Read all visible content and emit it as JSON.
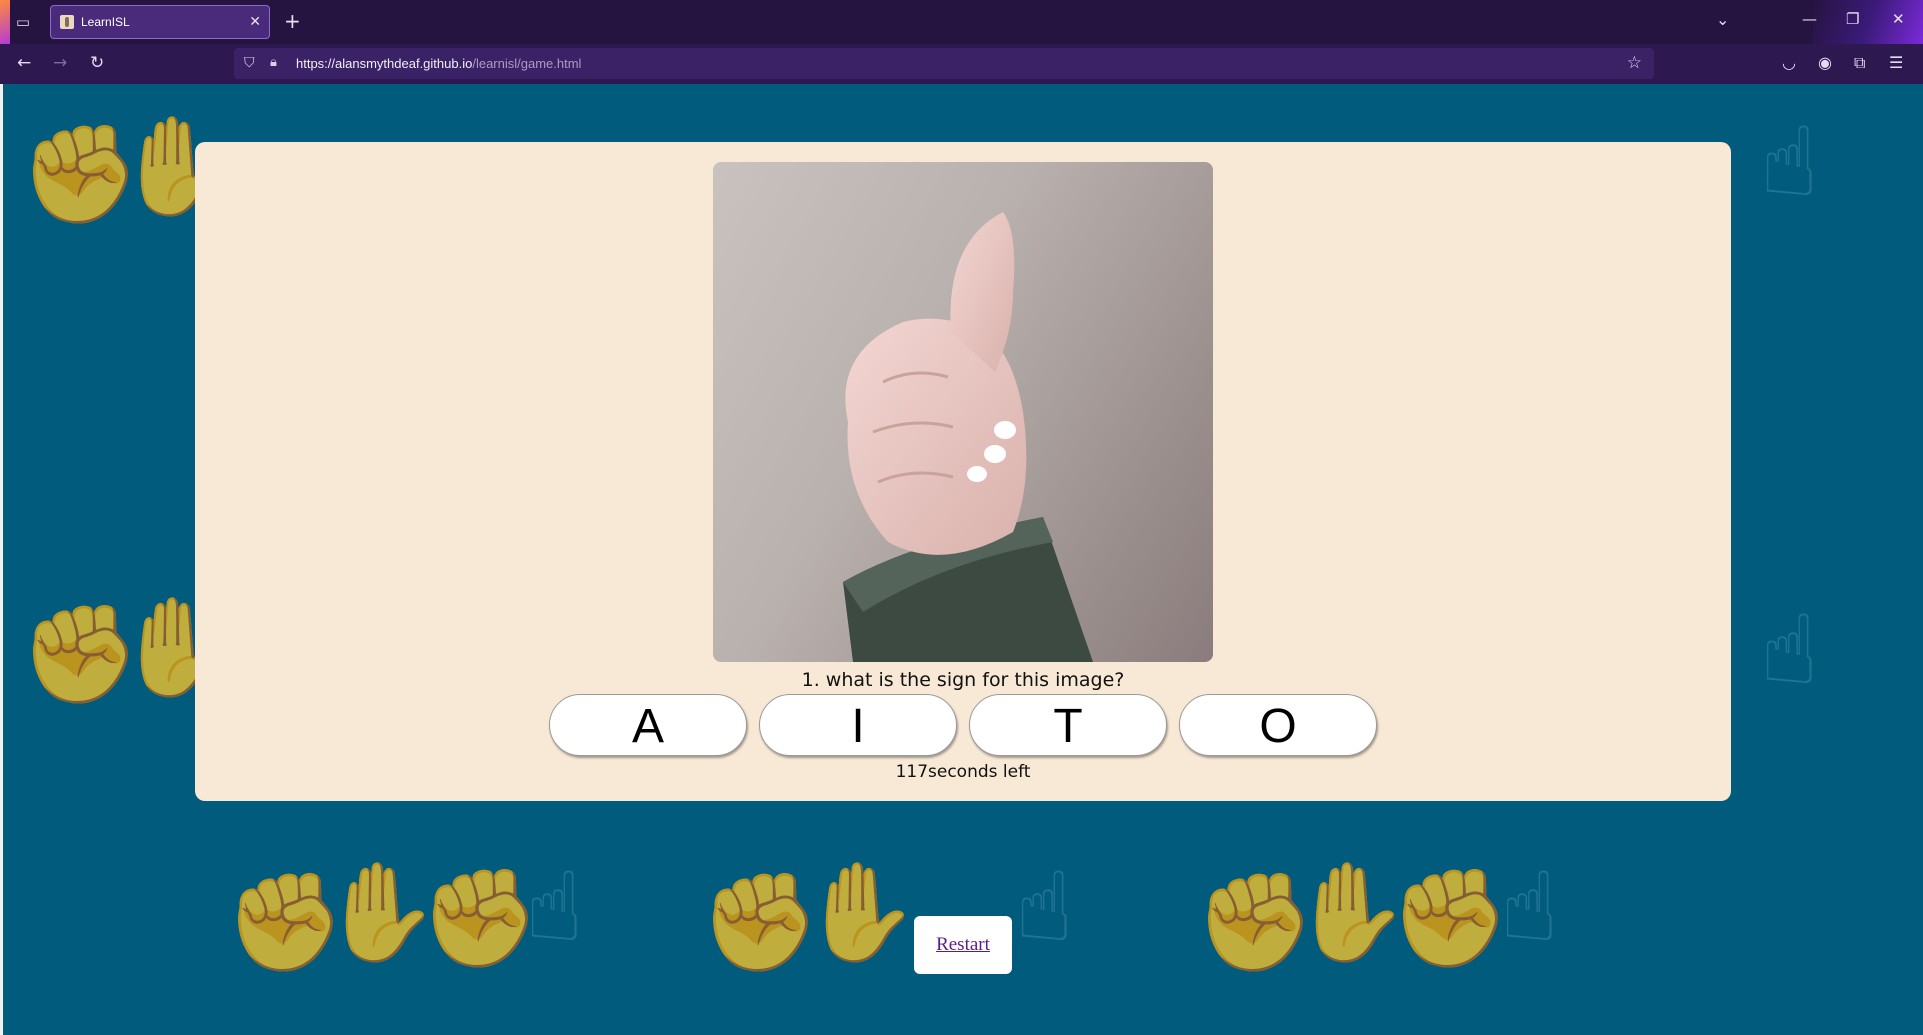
{
  "browser": {
    "tab_title": "LearnISL",
    "url_domain": "https://alansmythdeaf.github.io",
    "url_path": "/learnisl/game.html"
  },
  "icons": {
    "tab_list": "tab-list-icon",
    "new_tab": "plus-icon",
    "close_tab": "close-icon",
    "back": "back-arrow-icon",
    "forward": "forward-arrow-icon",
    "reload": "reload-icon",
    "shield": "shield-icon",
    "lock": "lock-icon",
    "bookmark": "star-icon",
    "pocket": "pocket-icon",
    "account": "account-icon",
    "extensions": "puzzle-icon",
    "menu": "hamburger-icon"
  },
  "game": {
    "question": "1. what is the sign for this image?",
    "answers": [
      "A",
      "I",
      "T",
      "O"
    ],
    "timer_text": "117seconds left",
    "image_subject": "hand sign photo (thumbs up fist)"
  },
  "restart_label": "Restart",
  "colors": {
    "page_bg": "#005b7d",
    "card_bg": "#f8e9d6",
    "pattern_hand": "#2c7c99",
    "link": "#5b1c8c",
    "chrome_bg": "#261440"
  }
}
